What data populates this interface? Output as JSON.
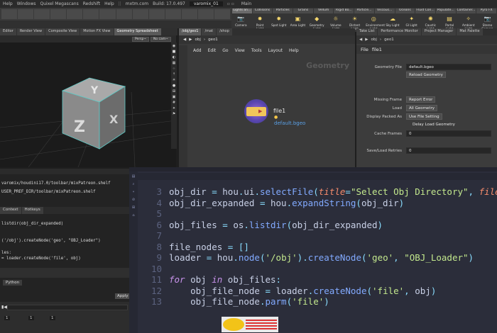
{
  "topbar": {
    "menus": [
      "Help",
      "Windows",
      "Quixel Megascans",
      "Redshift",
      "Help"
    ],
    "app": "mxtm.com",
    "build": "Build: 17.0.497",
    "scene": "varomix_01",
    "desktop": "Main"
  },
  "shelf": {
    "lights_tabs": [
      "Lights an...",
      "Collisions",
      "Particles",
      "Grains",
      "Vellum",
      "Rigid Bo...",
      "Particle...",
      "Viscous...",
      "Oceans",
      "Fluid Con...",
      "Populate...",
      "Container...",
      "Pyro FX"
    ],
    "tools": [
      {
        "label": "Camera",
        "icon": "camera-icon",
        "glyph": "📷"
      },
      {
        "label": "Point Light",
        "icon": "point-light-icon",
        "glyph": "✸"
      },
      {
        "label": "Spot Light",
        "icon": "spot-light-icon",
        "glyph": "✸"
      },
      {
        "label": "Area Light",
        "icon": "area-light-icon",
        "glyph": "▣"
      },
      {
        "label": "Geometry Light",
        "icon": "geometry-light-icon",
        "glyph": "◆"
      },
      {
        "label": "Volume Light",
        "icon": "volume-light-icon",
        "glyph": "☼"
      },
      {
        "label": "Distant Light",
        "icon": "distant-light-icon",
        "glyph": "☀"
      },
      {
        "label": "Environment Light",
        "icon": "environment-light-icon",
        "glyph": "◎"
      },
      {
        "label": "Sky Light",
        "icon": "sky-light-icon",
        "glyph": "☁"
      },
      {
        "label": "GI Light",
        "icon": "gi-light-icon",
        "glyph": "✦"
      },
      {
        "label": "Caustic Light",
        "icon": "caustic-light-icon",
        "glyph": "✺"
      },
      {
        "label": "Portal Light",
        "icon": "portal-light-icon",
        "glyph": "▤"
      },
      {
        "label": "Ambient Light",
        "icon": "ambient-light-icon",
        "glyph": "✧"
      },
      {
        "label": "Stereo Camera",
        "icon": "stereo-camera-icon",
        "glyph": "📷"
      }
    ]
  },
  "left_tabs": [
    "Editor",
    "Render View",
    "Composite View",
    "Motion FX View",
    "Geometry Spreadsheet"
  ],
  "viewport": {
    "persp": "Persp~",
    "cam": "No cam~",
    "cube_letters": {
      "top": "Y",
      "front": "Z",
      "side": "X"
    }
  },
  "network": {
    "tabs": [
      "/obj/geo1",
      "/mat",
      "/shop"
    ],
    "path": [
      "obj",
      "geo1"
    ],
    "menu": [
      "Add",
      "Edit",
      "Go",
      "View",
      "Tools",
      "Layout",
      "Help"
    ],
    "context_label": "Geometry",
    "node_name": "file1",
    "node_file": "default.bgeo",
    "node_color": "#f0c65a"
  },
  "params": {
    "tabs": [
      "Take List",
      "Performance Monitor",
      "Project Manager",
      "Mat Palette"
    ],
    "path": [
      "obj",
      "geo1"
    ],
    "node_type": "File",
    "node_name": "file1",
    "rows": [
      {
        "label": "Geometry File",
        "value": "default.bgeo",
        "style": "field"
      },
      {
        "label": "",
        "value": "Reload Geometry",
        "style": "btn"
      },
      {
        "label": "Missing Frame",
        "value": "Report Error",
        "style": "btn"
      },
      {
        "label": "Load",
        "value": "All Geometry",
        "style": "btn"
      },
      {
        "label": "Display Packed As",
        "value": "Use File Setting",
        "style": "btn"
      },
      {
        "label": "",
        "value": "Delay Load Geometry",
        "style": "check"
      },
      {
        "label": "Cache Frames",
        "value": "0",
        "style": "field"
      },
      {
        "label": "Save/Load Retries",
        "value": "0",
        "style": "field"
      }
    ]
  },
  "lower_left": {
    "path_line_1": "varomix/houdini17.0/toolbar/mixPatreon.shelf",
    "path_line_2": "USER_PREF_DIR/toolbar/mixPatreon.shelf",
    "tabs": [
      "Context",
      "Hotkeys"
    ],
    "snippets": [
      "listdir(obj_dir_expanded)",
      "('/obj').createNode('geo', \"OBJ_Loader\")",
      "les:",
      "= loader.createNode('file', obj)"
    ],
    "language": "Python",
    "apply_label": "Apply"
  },
  "timeline": {
    "frame_start": "1",
    "frame_end": "1",
    "frame_cur": "1"
  },
  "editor": {
    "lines": [
      {
        "n": "3",
        "text": "obj_dir = hou.ui.selectFile(title=\"Select Obj Directory\", file_type="
      },
      {
        "n": "4",
        "text": "obj_dir_expanded = hou.expandString(obj_dir)"
      },
      {
        "n": "5",
        "text": ""
      },
      {
        "n": "6",
        "text": "obj_files = os.listdir(obj_dir_expanded)"
      },
      {
        "n": "7",
        "text": ""
      },
      {
        "n": "8",
        "text": "file_nodes = []"
      },
      {
        "n": "9",
        "text": "loader = hou.node('/obj').createNode('geo', \"OBJ_Loader\")"
      },
      {
        "n": "10",
        "text": ""
      },
      {
        "n": "11",
        "text": "for obj in obj_files:"
      },
      {
        "n": "12",
        "text": "    obj_file_node = loader.createNode('file', obj)"
      },
      {
        "n": "13",
        "text": "    obj_file_node.parm('file')"
      }
    ]
  },
  "colors": {
    "accent_blue": "#5aa0e6",
    "selected_tab": "#5a5a5a"
  }
}
